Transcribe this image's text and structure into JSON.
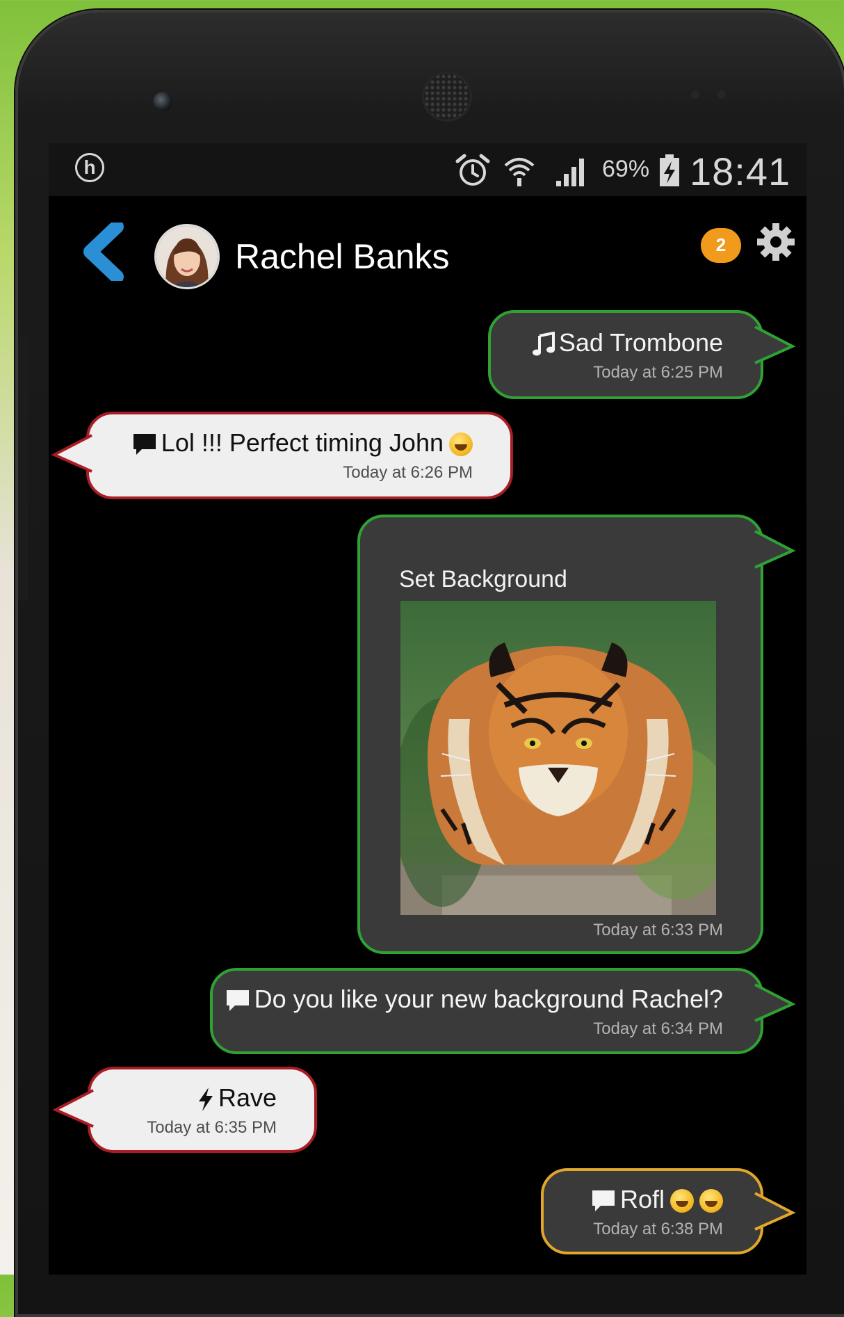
{
  "status_bar": {
    "battery_percent": "69%",
    "time": "18:41",
    "icons": [
      "h-icon",
      "alarm-icon",
      "wifi-icon",
      "signal-icon",
      "battery-charging-icon"
    ]
  },
  "header": {
    "contact_name": "Rachel Banks",
    "notification_count": "2",
    "icons": [
      "back-chevron-icon",
      "avatar",
      "gear-icon"
    ]
  },
  "messages": [
    {
      "direction": "out",
      "icon": "music-note-icon",
      "text": "Sad Trombone",
      "time": "Today at 6:25 PM"
    },
    {
      "direction": "in",
      "icon": "speech-bubble-icon",
      "text": "Lol !!! Perfect timing John",
      "emoji": "laughing-emoji",
      "time": "Today at 6:26 PM"
    },
    {
      "direction": "out",
      "type": "image",
      "title": "Set Background",
      "image": "tiger-photo",
      "time": "Today at 6:33 PM"
    },
    {
      "direction": "out",
      "icon": "speech-bubble-icon",
      "text": "Do you like your new background Rachel?",
      "time": "Today at 6:34 PM"
    },
    {
      "direction": "in",
      "icon": "lightning-icon",
      "text": "Rave",
      "time": "Today at 6:35 PM"
    },
    {
      "direction": "out",
      "icon": "speech-bubble-icon",
      "text": "Rofl",
      "emoji": "laughing-emoji",
      "time": "Today at 6:38 PM"
    }
  ],
  "colors": {
    "outgoing_border": "#2fa233",
    "outgoing_highlight_border": "#e1a72a",
    "incoming_border": "#a81d24",
    "badge": "#f29a1b",
    "back_chevron": "#2b8fd6"
  }
}
